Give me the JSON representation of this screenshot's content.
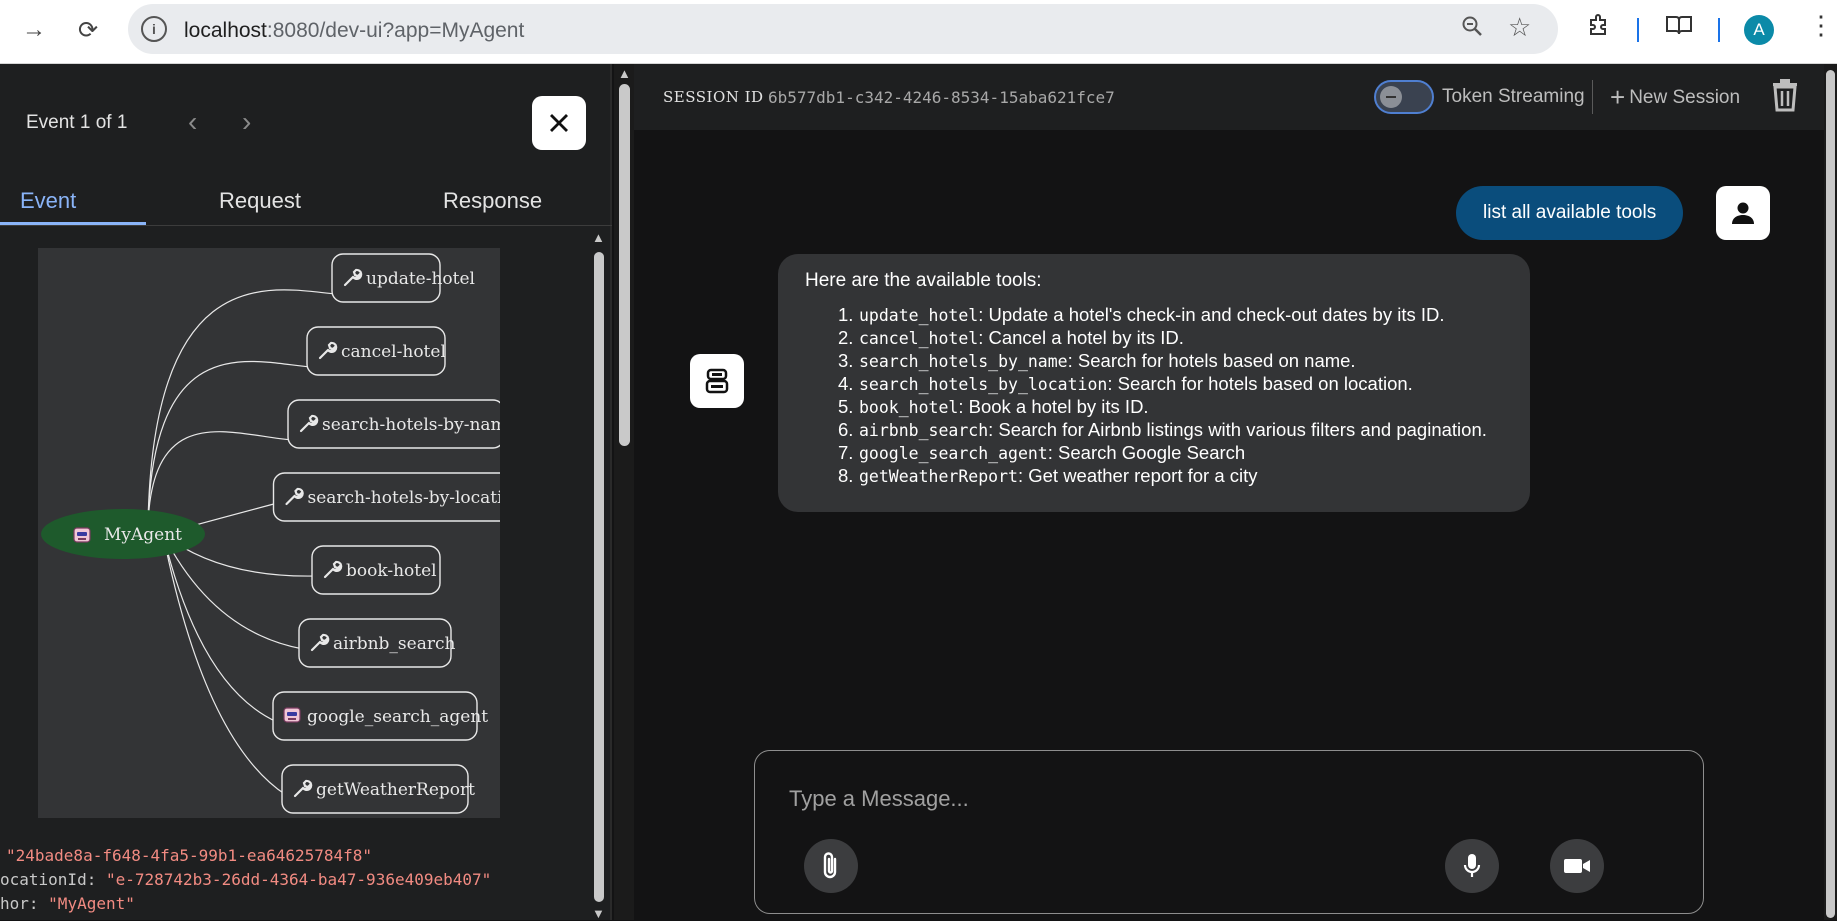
{
  "browser": {
    "url_host": "localhost",
    "url_rest": ":8080/dev-ui?app=MyAgent",
    "avatar_letter": "A"
  },
  "event_panel": {
    "event_count": "Event 1 of 1",
    "tabs": [
      "Event",
      "Request",
      "Response"
    ],
    "active_tab": "Event",
    "graph": {
      "root": "MyAgent",
      "nodes": [
        {
          "label": "update-hotel",
          "icon": "wrench-icon"
        },
        {
          "label": "cancel-hotel",
          "icon": "wrench-icon"
        },
        {
          "label": "search-hotels-by-name",
          "icon": "wrench-icon"
        },
        {
          "label": "search-hotels-by-location",
          "icon": "wrench-icon"
        },
        {
          "label": "book-hotel",
          "icon": "wrench-icon"
        },
        {
          "label": "airbnb_search",
          "icon": "wrench-icon"
        },
        {
          "label": "google_search_agent",
          "icon": "robot-icon"
        },
        {
          "label": "getWeatherReport",
          "icon": "wrench-icon"
        }
      ]
    },
    "json_lines": [
      {
        "key": "",
        "value": "\"24bade8a-f648-4fa5-99b1-ea64625784f8\""
      },
      {
        "key": "ocationId:",
        "value": "\"e-728742b3-26dd-4364-ba47-936e409eb407\""
      },
      {
        "key": "hor:",
        "value": "\"MyAgent\""
      }
    ]
  },
  "session": {
    "label": "SESSION ID",
    "id": "6b577db1-c342-4246-8534-15aba621fce7",
    "token_streaming_label": "Token Streaming",
    "token_streaming_on": false,
    "new_session_label": "New Session"
  },
  "chat": {
    "user_message": "list all available tools",
    "bot_intro": "Here are the available tools:",
    "tools": [
      {
        "num": "1.",
        "code": "update_hotel",
        "desc": ": Update a hotel's check-in and check-out dates by its ID."
      },
      {
        "num": "2.",
        "code": "cancel_hotel",
        "desc": ": Cancel a hotel by its ID."
      },
      {
        "num": "3.",
        "code": "search_hotels_by_name",
        "desc": ": Search for hotels based on name."
      },
      {
        "num": "4.",
        "code": "search_hotels_by_location",
        "desc": ": Search for hotels based on location."
      },
      {
        "num": "5.",
        "code": "book_hotel",
        "desc": ": Book a hotel by its ID."
      },
      {
        "num": "6.",
        "code": "airbnb_search",
        "desc": ": Search for Airbnb listings with various filters and pagination."
      },
      {
        "num": "7.",
        "code": "google_search_agent",
        "desc": ": Search Google Search"
      },
      {
        "num": "8.",
        "code": "getWeatherReport",
        "desc": ": Get weather report for a city"
      }
    ]
  },
  "composer": {
    "placeholder": "Type a Message...",
    "value": ""
  },
  "colors": {
    "accent": "#8ab4f8",
    "user_bubble": "#0a4d7c",
    "root_node": "#1e5a2c",
    "json_string": "#f28b82"
  }
}
